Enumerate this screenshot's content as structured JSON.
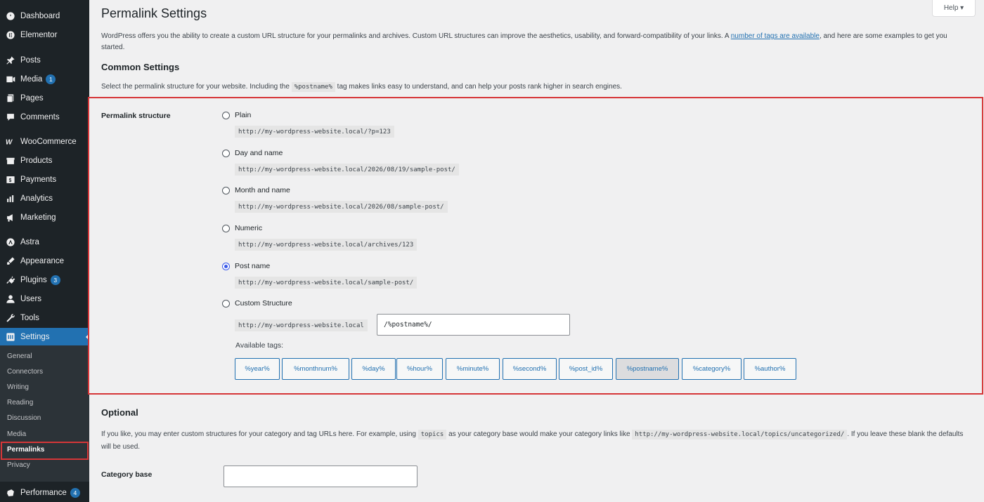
{
  "sidebar": {
    "items": [
      {
        "label": "Dashboard",
        "icon": "dashboard-icon"
      },
      {
        "label": "Elementor",
        "icon": "elementor-icon"
      },
      {
        "label": "Posts",
        "icon": "pin-icon"
      },
      {
        "label": "Media",
        "icon": "media-icon",
        "badge": "1"
      },
      {
        "label": "Pages",
        "icon": "pages-icon"
      },
      {
        "label": "Comments",
        "icon": "comments-icon"
      },
      {
        "label": "WooCommerce",
        "icon": "woocommerce-icon"
      },
      {
        "label": "Products",
        "icon": "products-icon"
      },
      {
        "label": "Payments",
        "icon": "payments-icon"
      },
      {
        "label": "Analytics",
        "icon": "analytics-icon"
      },
      {
        "label": "Marketing",
        "icon": "marketing-icon"
      },
      {
        "label": "Astra",
        "icon": "astra-icon"
      },
      {
        "label": "Appearance",
        "icon": "appearance-icon"
      },
      {
        "label": "Plugins",
        "icon": "plugins-icon",
        "badge": "3"
      },
      {
        "label": "Users",
        "icon": "users-icon"
      },
      {
        "label": "Tools",
        "icon": "tools-icon"
      },
      {
        "label": "Settings",
        "icon": "settings-icon"
      },
      {
        "label": "Performance",
        "icon": "performance-icon",
        "badge": "4"
      }
    ],
    "submenu": [
      "General",
      "Connectors",
      "Writing",
      "Reading",
      "Discussion",
      "Media",
      "Permalinks",
      "Privacy"
    ]
  },
  "header": {
    "title": "Permalink Settings",
    "help_label": "Help ▾"
  },
  "intro": {
    "text_before": "WordPress offers you the ability to create a custom URL structure for your permalinks and archives. Custom URL structures can improve the aesthetics, usability, and forward-compatibility of your links. A ",
    "link": "number of tags are available",
    "text_after": ", and here are some examples to get you started."
  },
  "common": {
    "heading": "Common Settings",
    "desc_before": "Select the permalink structure for your website. Including the",
    "desc_code": "%postname%",
    "desc_after": "tag makes links easy to understand, and can help your posts rank higher in search engines.",
    "field_label": "Permalink structure",
    "options": [
      {
        "label": "Plain",
        "url": "http://my-wordpress-website.local/?p=123",
        "checked": false
      },
      {
        "label": "Day and name",
        "url": "http://my-wordpress-website.local/2026/08/19/sample-post/",
        "checked": false
      },
      {
        "label": "Month and name",
        "url": "http://my-wordpress-website.local/2026/08/sample-post/",
        "checked": false
      },
      {
        "label": "Numeric",
        "url": "http://my-wordpress-website.local/archives/123",
        "checked": false
      },
      {
        "label": "Post name",
        "url": "http://my-wordpress-website.local/sample-post/",
        "checked": true
      },
      {
        "label": "Custom Structure",
        "url": "",
        "checked": false
      }
    ],
    "custom_base": "http://my-wordpress-website.local",
    "custom_value": "/%postname%/",
    "available_tags_label": "Available tags:",
    "tags": [
      "%year%",
      "%monthnum%",
      "%day%",
      "%hour%",
      "%minute%",
      "%second%",
      "%post_id%",
      "%postname%",
      "%category%",
      "%author%"
    ],
    "active_tag": "%postname%"
  },
  "optional": {
    "heading": "Optional",
    "desc_1": "If you like, you may enter custom structures for your category and tag URLs here. For example, using",
    "code_1": "topics",
    "desc_2": "as your category base would make your category links like",
    "code_2": "http://my-wordpress-website.local/topics/uncategorized/",
    "desc_3": ". If you leave these blank the defaults will be used.",
    "category_base_label": "Category base",
    "category_base_value": ""
  },
  "colors": {
    "sidebar_bg": "#1d2327",
    "accent": "#2271b1",
    "highlight": "#d63638",
    "radio_checked": "#3858e9"
  }
}
